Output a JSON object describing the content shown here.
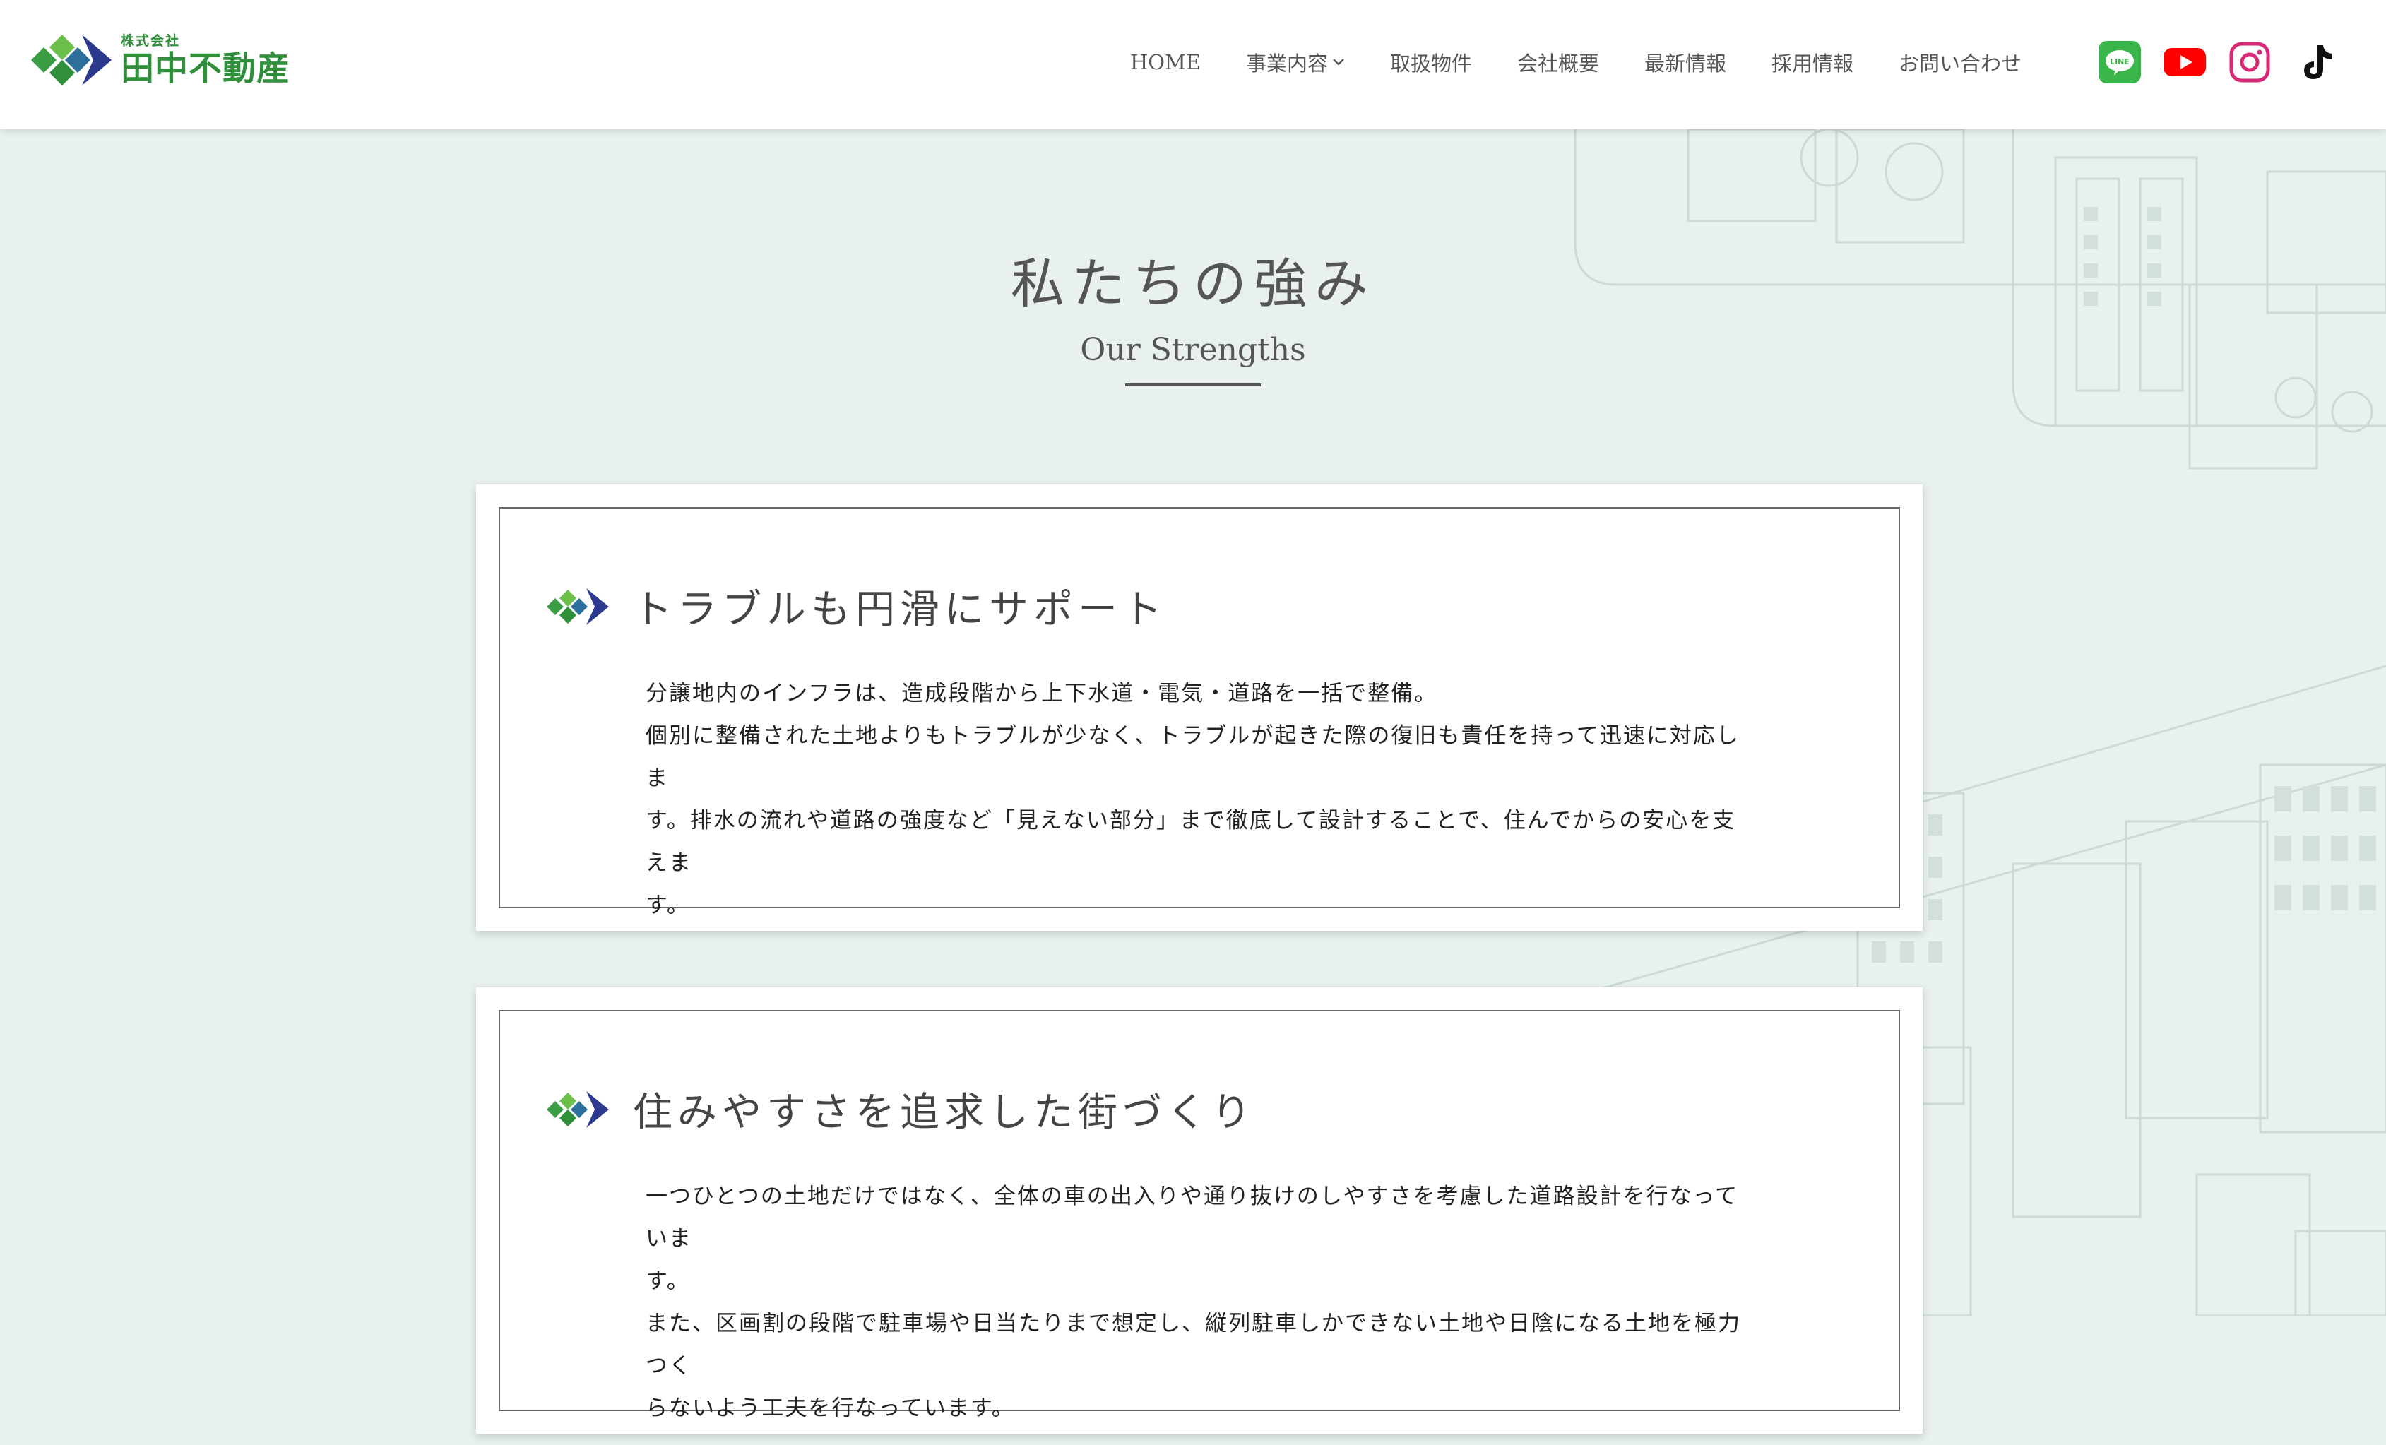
{
  "header": {
    "logo": {
      "small": "株式会社",
      "name": "田中不動産"
    },
    "nav": [
      {
        "label": "HOME"
      },
      {
        "label": "事業内容",
        "has_dropdown": true
      },
      {
        "label": "取扱物件"
      },
      {
        "label": "会社概要"
      },
      {
        "label": "最新情報"
      },
      {
        "label": "採用情報"
      },
      {
        "label": "お問い合わせ"
      }
    ],
    "social": [
      "line-icon",
      "youtube-icon",
      "instagram-icon",
      "tiktok-icon"
    ]
  },
  "section": {
    "title_ja": "私たちの強み",
    "title_en": "Our Strengths"
  },
  "cards": [
    {
      "title": "トラブルも円滑にサポート",
      "lines": [
        "分譲地内のインフラは、造成段階から上下水道・電気・道路を一括で整備。",
        "個別に整備された土地よりもトラブルが少なく、トラブルが起きた際の復旧も責任を持って迅速に対応しま",
        "す。排水の流れや道路の強度など「見えない部分」まで徹底して設計することで、住んでからの安心を支えま",
        "す。"
      ]
    },
    {
      "title": "住みやすさを追求した街づくり",
      "lines": [
        "一つひとつの土地だけではなく、全体の車の出入りや通り抜けのしやすさを考慮した道路設計を行なっていま",
        "す。",
        "また、区画割の段階で駐車場や日当たりまで想定し、縦列駐車しかできない土地や日陰になる土地を極力つく",
        "らないよう工夫を行なっています。"
      ]
    }
  ],
  "colors": {
    "brand_green": "#2f8f3a",
    "brand_navy": "#2b3a8c",
    "background": "#e9f1f0",
    "line_green": "#39b54a",
    "youtube_red": "#ff0000",
    "instagram_pink": "#d62976"
  }
}
